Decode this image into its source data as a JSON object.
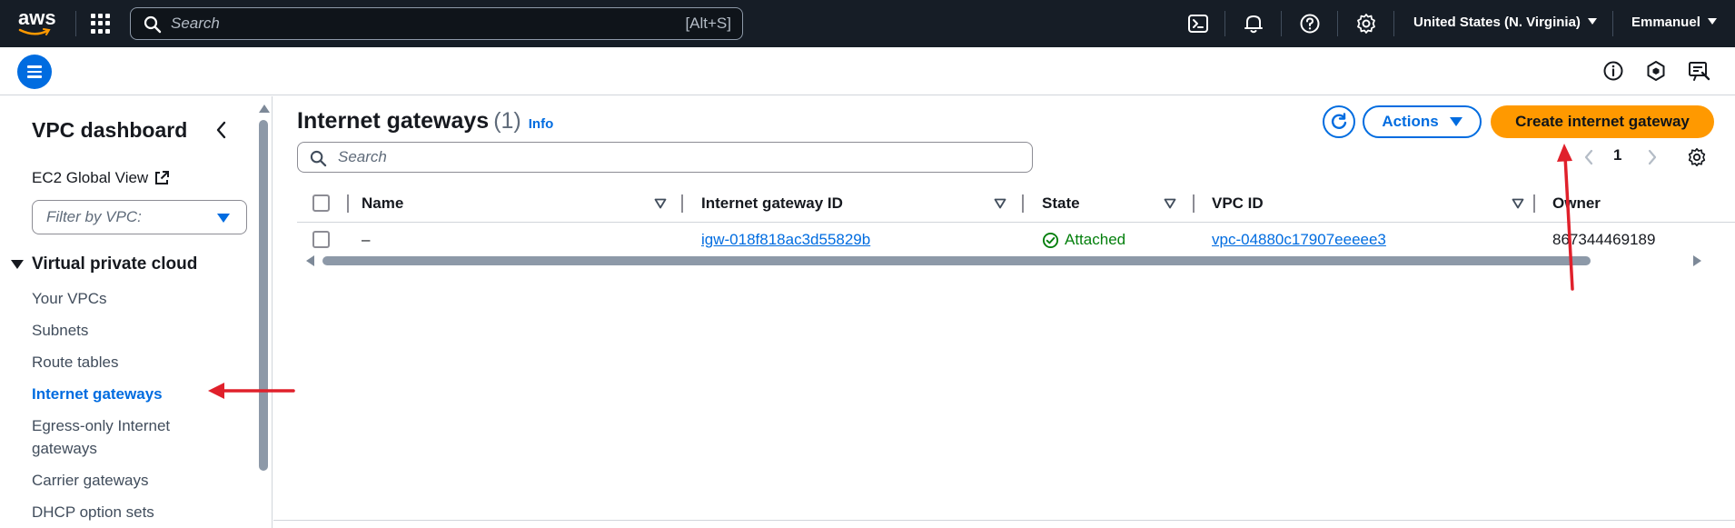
{
  "topnav": {
    "logo_text": "aws",
    "search_placeholder": "Search",
    "search_shortcut": "[Alt+S]",
    "icons": [
      "apps-grid-icon",
      "search-icon",
      "cloudshell-icon",
      "bell-icon",
      "help-icon",
      "gear-icon"
    ],
    "region": "United States (N. Virginia)",
    "user": "Emmanuel"
  },
  "subbar": {
    "icons": [
      "menu-icon",
      "info-icon",
      "hexagon-icon",
      "feedback-icon"
    ]
  },
  "sidebar": {
    "title": "VPC dashboard",
    "ec2_global_view": "EC2 Global View",
    "filter_placeholder": "Filter by VPC:",
    "section": "Virtual private cloud",
    "items": [
      {
        "label": "Your VPCs",
        "active": false
      },
      {
        "label": "Subnets",
        "active": false
      },
      {
        "label": "Route tables",
        "active": false
      },
      {
        "label": "Internet gateways",
        "active": true
      },
      {
        "label": "Egress-only Internet",
        "active": false
      },
      {
        "label": "gateways",
        "active": false
      },
      {
        "label": "Carrier gateways",
        "active": false
      },
      {
        "label": "DHCP option sets",
        "active": false
      }
    ]
  },
  "main": {
    "title": "Internet gateways",
    "count": "(1)",
    "info": "Info",
    "actions_label": "Actions",
    "create_label": "Create internet gateway",
    "search_placeholder": "Search",
    "page_number": "1",
    "columns": [
      "Name",
      "Internet gateway ID",
      "State",
      "VPC ID",
      "Owner"
    ],
    "rows": [
      {
        "name": "–",
        "gateway_id": "igw-018f818ac3d55829b",
        "state": "Attached",
        "vpc_id": "vpc-04880c17907eeeee3",
        "owner": "867344469189"
      }
    ]
  },
  "colors": {
    "nav_bg": "#161d26",
    "accent_blue": "#006ce0",
    "primary_orange": "#ff9900",
    "success_green": "#037f0c",
    "annotation_red": "#e0202b"
  }
}
